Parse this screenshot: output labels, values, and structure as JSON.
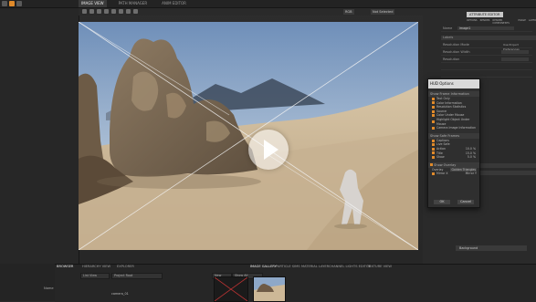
{
  "top_tabs": [
    "IMAGE VIEW",
    "PATH MANAGER",
    "ANIM EDITOR"
  ],
  "viewport": {
    "dropdown_1": "RGB",
    "dropdown_2": "Not Selected",
    "play": "play-icon"
  },
  "right_panel": {
    "header_label": "ATTRIBUTE EDITOR",
    "sub_tabs": [
      "OPTIONS",
      "RENDER",
      "RENDER COMPONENTS",
      "IMAGE",
      "LAYER"
    ],
    "name_label": "Name",
    "name_value": "image1",
    "section_label": "Labels",
    "rows": [
      {
        "label": "Resolution Mode",
        "value": "Use Project Preferences"
      },
      {
        "label": "Resolution Width",
        "value": ""
      },
      {
        "label": "Resolution",
        "value": ""
      }
    ]
  },
  "dialog": {
    "title": "HUD Options",
    "section1": "Show Frame Information",
    "items1": [
      "Text Only",
      "Color Information",
      "Resolution Statistics",
      "Source",
      "Color Under Mouse",
      "Highlight Object Under Mouse",
      "Camera Image Information"
    ],
    "section2": "Show Safe Frames",
    "items2": [
      "Captions",
      "Live Safe",
      "Action",
      "Title",
      "Show"
    ],
    "percents": [
      "10.0 %",
      "15.0 %",
      "5.0 %"
    ],
    "section3": "Show Overlay",
    "overlay_label": "Overlay",
    "overlay_value": "Golden Triangles",
    "mirror_label": "Mirror X",
    "mirror_value": "Mirror Y",
    "ok": "OK",
    "cancel": "Cancel"
  },
  "bottom": {
    "tabs": [
      "BROWSER",
      "HIERARCHY VIEW",
      "EXPLORER"
    ],
    "mid_tabs": [
      "IMAGE GALLERY",
      "PARTICLE SIMS",
      "MATERIAL LAYER",
      "CHANNEL LIGHTS EDITOR",
      "TEXTURE VIEW"
    ],
    "list_view": "List View",
    "project_root": "Project Root",
    "new_label": "New",
    "show_all": "Show All",
    "name_header": "Name",
    "tree_item": "camera_01",
    "layer_label": "Background"
  },
  "colors": {
    "accent": "#e08a2a",
    "sky": "#7f9fc9",
    "sand": "#c9b393"
  }
}
